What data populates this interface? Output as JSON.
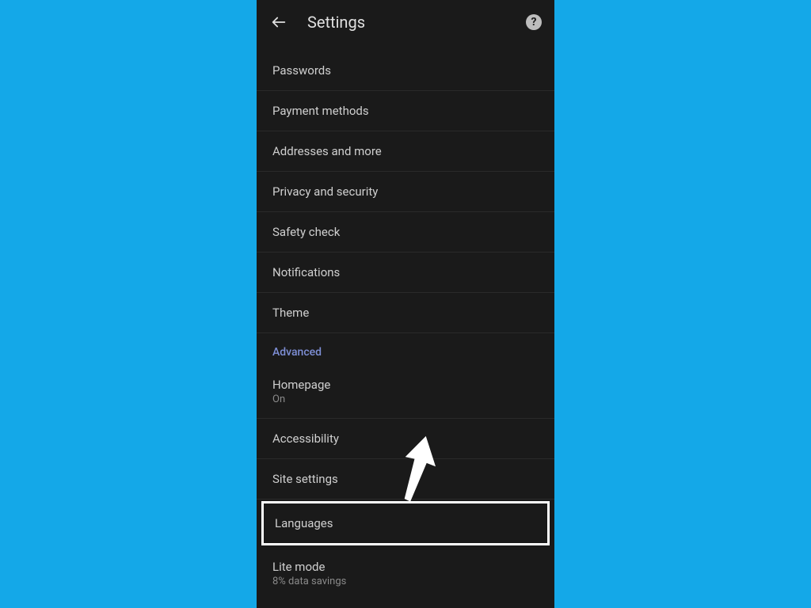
{
  "header": {
    "title": "Settings"
  },
  "items": {
    "passwords": "Passwords",
    "payment": "Payment methods",
    "addresses": "Addresses and more",
    "privacy": "Privacy and security",
    "safety": "Safety check",
    "notifications": "Notifications",
    "theme": "Theme",
    "advancedHeader": "Advanced",
    "homepage": {
      "label": "Homepage",
      "sub": "On"
    },
    "accessibility": "Accessibility",
    "site": "Site settings",
    "languages": "Languages",
    "lite": {
      "label": "Lite mode",
      "sub": "8% data savings"
    }
  }
}
